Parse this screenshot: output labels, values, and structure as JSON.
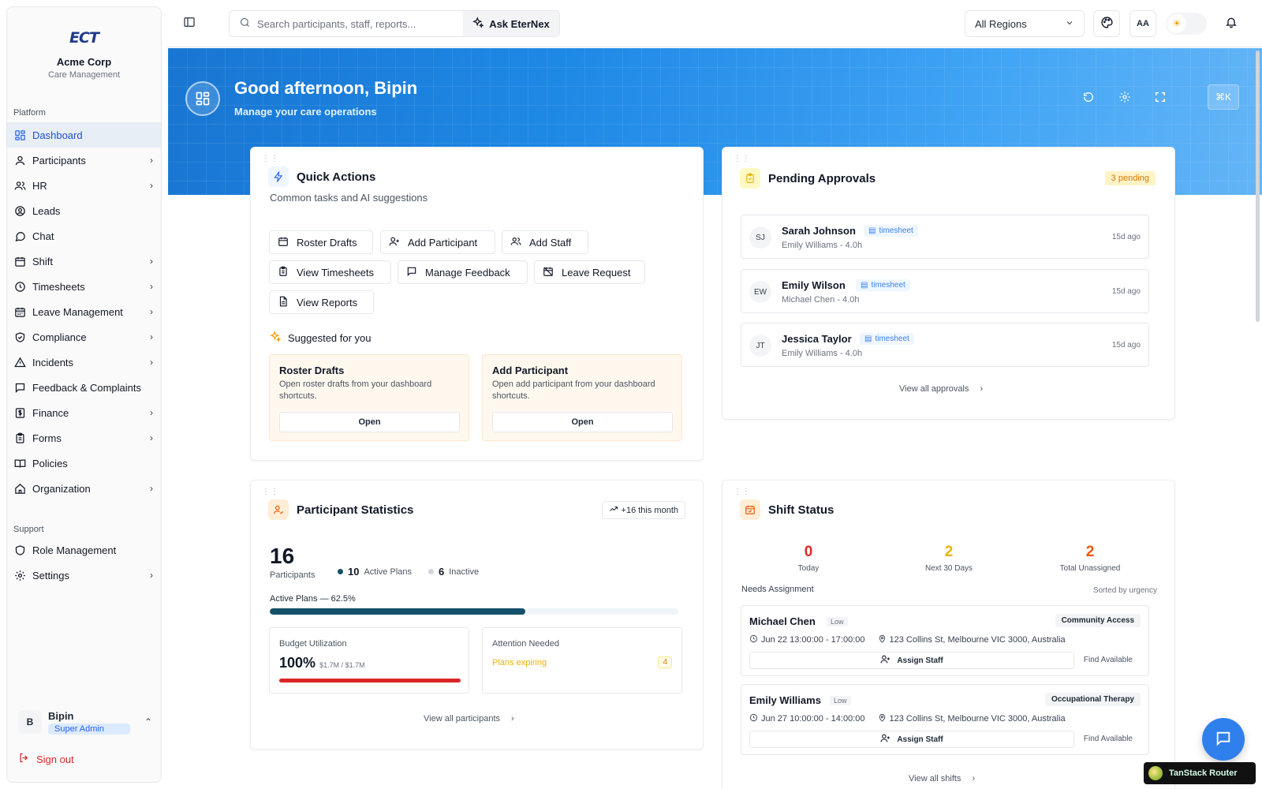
{
  "brand": {
    "logo_text": "ECT",
    "name": "Acme Corp",
    "subtitle": "Care Management"
  },
  "sidebar": {
    "platform_label": "Platform",
    "items": [
      {
        "label": "Dashboard",
        "icon": "dashboard-icon",
        "active": true,
        "chevron": false
      },
      {
        "label": "Participants",
        "icon": "user-icon",
        "chevron": true
      },
      {
        "label": "HR",
        "icon": "users-icon",
        "chevron": true
      },
      {
        "label": "Leads",
        "icon": "user-circle-icon",
        "chevron": false
      },
      {
        "label": "Chat",
        "icon": "chat-icon",
        "chevron": false
      },
      {
        "label": "Shift",
        "icon": "calendar-icon",
        "chevron": true
      },
      {
        "label": "Timesheets",
        "icon": "clock-icon",
        "chevron": true
      },
      {
        "label": "Leave Management",
        "icon": "calendar-icon",
        "chevron": true
      },
      {
        "label": "Compliance",
        "icon": "shield-check-icon",
        "chevron": true
      },
      {
        "label": "Incidents",
        "icon": "warning-icon",
        "chevron": true
      },
      {
        "label": "Feedback & Complaints",
        "icon": "message-square-icon",
        "chevron": false
      },
      {
        "label": "Finance",
        "icon": "dollar-icon",
        "chevron": true
      },
      {
        "label": "Forms",
        "icon": "clipboard-icon",
        "chevron": true
      },
      {
        "label": "Policies",
        "icon": "book-icon",
        "chevron": false
      },
      {
        "label": "Organization",
        "icon": "home-icon",
        "chevron": true
      }
    ],
    "support_label": "Support",
    "support_items": [
      {
        "label": "Role Management",
        "icon": "shield-icon",
        "chevron": false
      },
      {
        "label": "Settings",
        "icon": "gear-icon",
        "chevron": true
      }
    ],
    "user": {
      "initial": "B",
      "name": "Bipin",
      "role": "Super Admin"
    },
    "signout": "Sign out"
  },
  "topbar": {
    "search_placeholder": "Search participants, staff, reports...",
    "ask_label": "Ask EterNex",
    "region": "All Regions",
    "font_label": "AA"
  },
  "hero": {
    "title": "Good afternoon, Bipin",
    "subtitle": "Manage your care operations",
    "shortcut": "⌘K"
  },
  "quick_actions": {
    "title": "Quick Actions",
    "subtitle": "Common tasks and AI suggestions",
    "buttons": [
      "Roster Drafts",
      "Add Participant",
      "Add Staff",
      "View Timesheets",
      "Manage Feedback",
      "Leave Request",
      "View Reports"
    ],
    "suggested_label": "Suggested for you",
    "suggestions": [
      {
        "title": "Roster Drafts",
        "desc": "Open roster drafts from your dashboard shortcuts.",
        "button": "Open"
      },
      {
        "title": "Add Participant",
        "desc": "Open add participant from your dashboard shortcuts.",
        "button": "Open"
      }
    ]
  },
  "approvals": {
    "title": "Pending Approvals",
    "badge": "3 pending",
    "items": [
      {
        "initials": "SJ",
        "name": "Sarah Johnson",
        "tag": "timesheet",
        "sub": "Emily Williams - 4.0h",
        "ago": "15d ago"
      },
      {
        "initials": "EW",
        "name": "Emily Wilson",
        "tag": "timesheet",
        "sub": "Michael Chen - 4.0h",
        "ago": "15d ago"
      },
      {
        "initials": "JT",
        "name": "Jessica Taylor",
        "tag": "timesheet",
        "sub": "Emily Williams - 4.0h",
        "ago": "15d ago"
      }
    ],
    "view_all": "View all approvals"
  },
  "participant_stats": {
    "title": "Participant Statistics",
    "trend": "+16 this month",
    "total": "16",
    "total_label": "Participants",
    "active_count": "10",
    "active_label": "Active Plans",
    "inactive_count": "6",
    "inactive_label": "Inactive",
    "progress_label": "Active Plans — 62.5%",
    "progress_value": 0.625,
    "budget_label": "Budget Utilization",
    "budget_value": "100%",
    "budget_sub": "$1.7M / $1.7M",
    "budget_fraction": 1.0,
    "attention_label": "Attention Needed",
    "attention_item": "Plans expiring",
    "attention_count": "4",
    "view_all": "View all participants"
  },
  "shift_status": {
    "title": "Shift Status",
    "stats": [
      {
        "value": "0",
        "label": "Today",
        "color": "#dc2626"
      },
      {
        "value": "2",
        "label": "Next 30 Days",
        "color": "#eab308"
      },
      {
        "value": "2",
        "label": "Total Unassigned",
        "color": "#ea580c"
      }
    ],
    "needs_label": "Needs Assignment",
    "sorted_label": "Sorted by urgency",
    "shifts": [
      {
        "name": "Michael Chen",
        "level": "Low",
        "service": "Community Access",
        "time": "Jun 22 13:00:00 - 17:00:00",
        "address": "123 Collins St, Melbourne VIC 3000, Australia",
        "assign": "Assign Staff",
        "find": "Find Available"
      },
      {
        "name": "Emily Williams",
        "level": "Low",
        "service": "Occupational Therapy",
        "time": "Jun 27 10:00:00 - 14:00:00",
        "address": "123 Collins St, Melbourne VIC 3000, Australia",
        "assign": "Assign Staff",
        "find": "Find Available"
      }
    ],
    "view_all": "View all shifts"
  },
  "devtools": {
    "label": "TanStack Router"
  },
  "colors": {
    "accent": "#2563eb",
    "hero_start": "#1976d2",
    "progress": "#14506a",
    "danger": "#dc2626"
  }
}
